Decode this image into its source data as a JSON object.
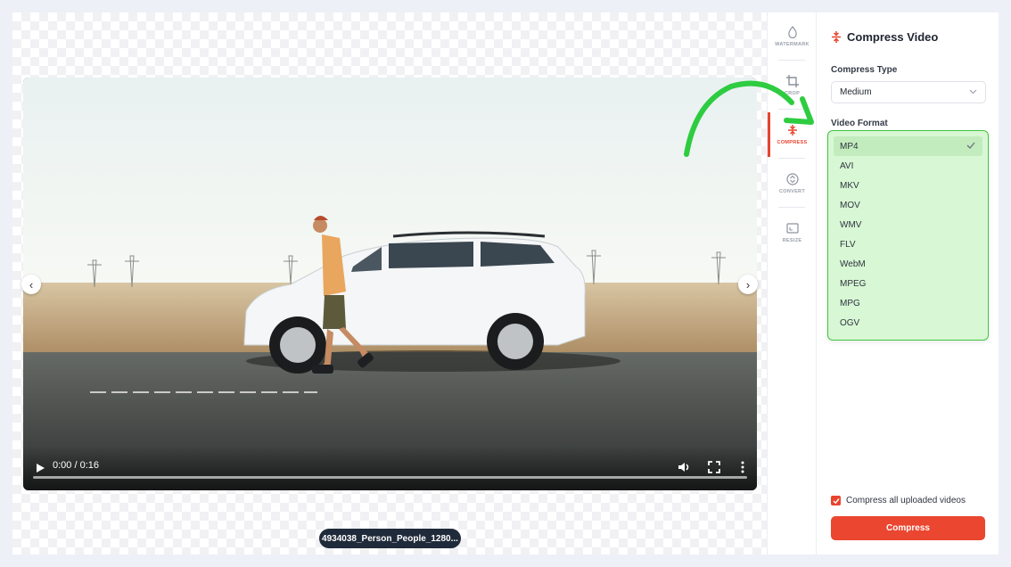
{
  "player": {
    "time": "0:00 / 0:16",
    "filename": "4934038_Person_People_1280..."
  },
  "toolbar": {
    "items": [
      {
        "label": "WATERMARK",
        "icon": "droplet-icon"
      },
      {
        "label": "CROP",
        "icon": "crop-icon"
      },
      {
        "label": "COMPRESS",
        "icon": "compress-icon"
      },
      {
        "label": "CONVERT",
        "icon": "convert-icon"
      },
      {
        "label": "RESIZE",
        "icon": "resize-icon"
      }
    ],
    "active": "COMPRESS"
  },
  "panel": {
    "title": "Compress Video",
    "compress_type_label": "Compress Type",
    "compress_type_value": "Medium",
    "video_format_label": "Video Format",
    "formats": [
      "MP4",
      "AVI",
      "MKV",
      "MOV",
      "WMV",
      "FLV",
      "WebM",
      "MPEG",
      "MPG",
      "OGV"
    ],
    "selected_format": "MP4",
    "compress_all_label": "Compress all uploaded videos",
    "compress_all_checked": true,
    "compress_button": "Compress"
  },
  "colors": {
    "accent": "#e8432e",
    "highlight_green": "#43c441"
  }
}
